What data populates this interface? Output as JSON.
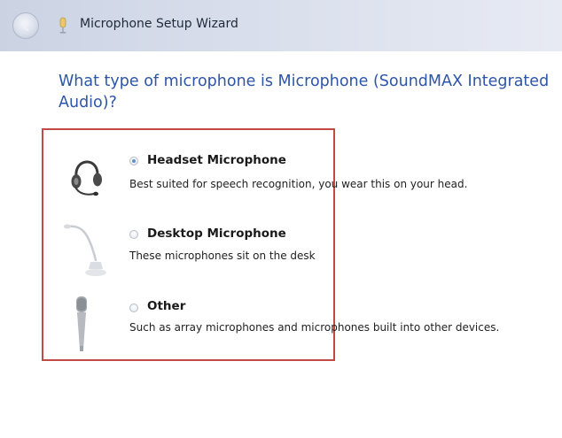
{
  "window": {
    "title": "Microphone Setup Wizard"
  },
  "question": "What type of microphone is Microphone (SoundMAX Integrated Audio)?",
  "options": [
    {
      "label": "Headset Microphone",
      "description": "Best suited for speech recognition, you wear this on your head.",
      "selected": true,
      "icon": "headset-icon"
    },
    {
      "label": "Desktop Microphone",
      "description": "These microphones sit on the desk",
      "selected": false,
      "icon": "desktop-microphone-icon"
    },
    {
      "label": "Other",
      "description": "Such as array microphones and microphones built into other devices.",
      "selected": false,
      "icon": "handheld-microphone-icon"
    }
  ],
  "colors": {
    "question_text": "#2d55a8",
    "highlight_border": "#c24a44",
    "title_bar": "#d6dcea"
  }
}
